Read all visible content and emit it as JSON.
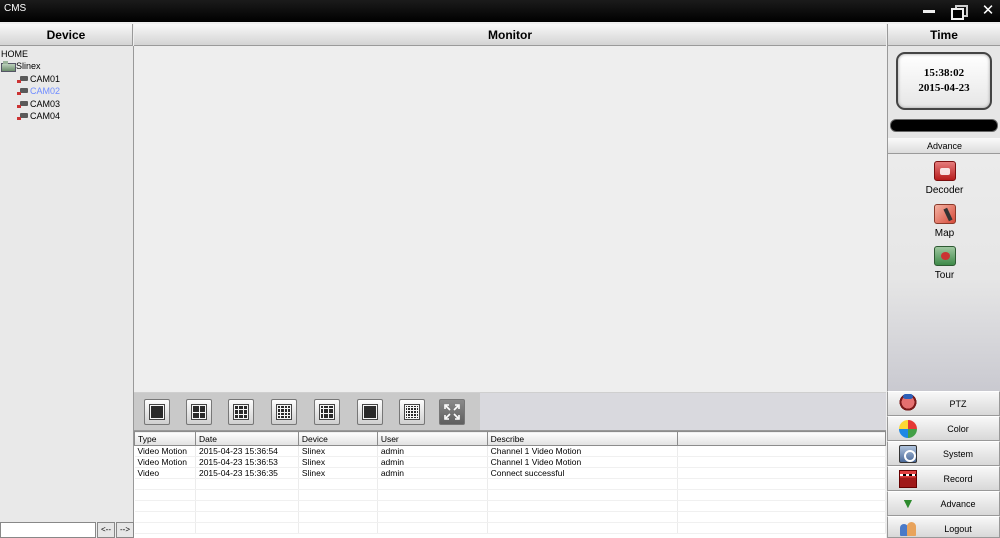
{
  "window": {
    "title": "CMS",
    "minimize_icon": "minimize-icon",
    "maximize_icon": "restore-icon",
    "close_label": "✕"
  },
  "panels": {
    "device_title": "Device",
    "monitor_title": "Monitor",
    "time_title": "Time"
  },
  "device_tree": {
    "root": "HOME",
    "group": "Slinex",
    "cameras": [
      "CAM01",
      "CAM02",
      "CAM03",
      "CAM04"
    ],
    "selected": "CAM02",
    "search_value": "",
    "prev_label": "<--",
    "next_label": "-->"
  },
  "clock": {
    "time": "15:38:02",
    "date": "2015-04-23"
  },
  "advance": {
    "header": "Advance",
    "items": [
      {
        "label": "Decoder",
        "icon": "decoder-icon"
      },
      {
        "label": "Map",
        "icon": "map-icon"
      },
      {
        "label": "Tour",
        "icon": "tour-icon"
      }
    ]
  },
  "menu": [
    {
      "label": "PTZ",
      "icon": "ptz-icon"
    },
    {
      "label": "Color",
      "icon": "color-icon"
    },
    {
      "label": "System",
      "icon": "system-icon"
    },
    {
      "label": "Record",
      "icon": "record-icon"
    },
    {
      "label": "Advance",
      "icon": "advance-icon"
    },
    {
      "label": "Logout",
      "icon": "logout-icon"
    }
  ],
  "layouts": [
    {
      "name": "1-split",
      "grid": 1
    },
    {
      "name": "4-split",
      "grid": 2
    },
    {
      "name": "9-split",
      "grid": 3
    },
    {
      "name": "16-split",
      "grid": 4
    },
    {
      "name": "25-split",
      "grid": 5
    },
    {
      "name": "36-split",
      "grid": 6
    },
    {
      "name": "64-split",
      "grid": 8
    },
    {
      "name": "fullscreen",
      "icon": "fullscreen-icon"
    }
  ],
  "log": {
    "columns": [
      "Type",
      "Date",
      "Device",
      "User",
      "Describe"
    ],
    "rows": [
      [
        "Video Motion",
        "2015-04-23 15:36:54",
        "Slinex",
        "admin",
        "Channel 1 Video Motion"
      ],
      [
        "Video Motion",
        "2015-04-23 15:36:53",
        "Slinex",
        "admin",
        "Channel 1 Video Motion"
      ],
      [
        "Video",
        "2015-04-23 15:36:35",
        "Slinex",
        "admin",
        "Connect successful"
      ]
    ]
  },
  "colors": {
    "selected_text": "#6f8cff",
    "titlebar": "#000000",
    "panel_bg": "#eeeeee"
  }
}
